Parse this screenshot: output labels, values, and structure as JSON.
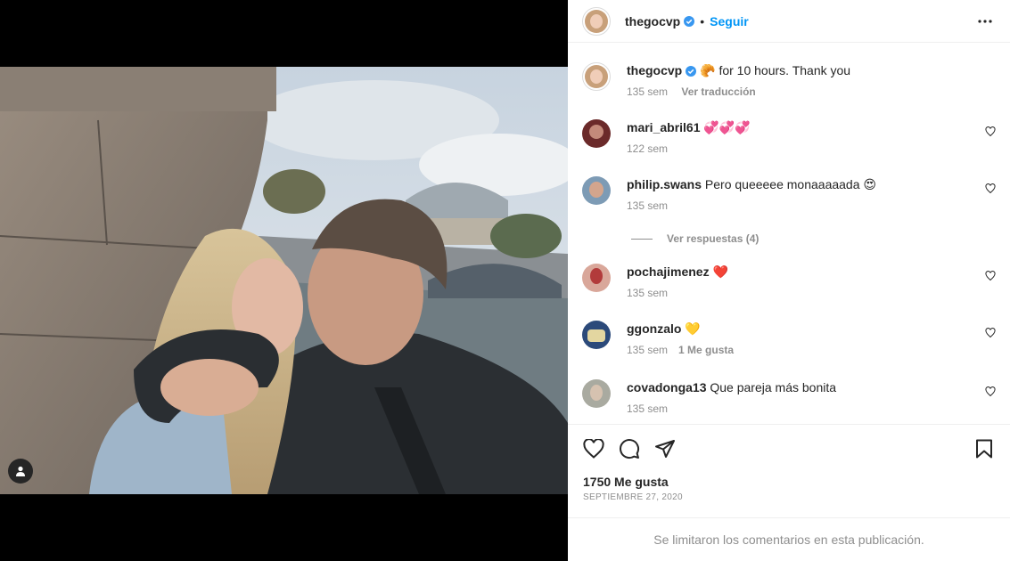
{
  "post": {
    "author": "thegocvp",
    "follow_label": "Seguir",
    "dot": "•",
    "caption_emoji": "🥐",
    "caption_text": "for 10 hours. Thank you",
    "caption_time": "135 sem",
    "translate_label": "Ver traducción"
  },
  "comments": [
    {
      "user": "mari_abril61",
      "text": "💞💞💞",
      "time": "122 sem",
      "likes": ""
    },
    {
      "user": "philip.swans",
      "text": "Pero queeeee monaaaaada 😍",
      "time": "135 sem",
      "likes": ""
    },
    {
      "user": "pochajimenez",
      "text": "❤️",
      "time": "135 sem",
      "likes": ""
    },
    {
      "user": "ggonzalo",
      "text": "💛",
      "time": "135 sem",
      "likes": "1 Me gusta"
    },
    {
      "user": "covadonga13",
      "text": "Que pareja más bonita",
      "time": "135 sem",
      "likes": ""
    }
  ],
  "replies_label": "Ver respuestas (4)",
  "likes_count": "1750 Me gusta",
  "date": "Septiembre 27, 2020",
  "comments_limited": "Se limitaron los comentarios en esta publicación.",
  "colors": {
    "accent": "#0095f6",
    "verified": "#3897f0",
    "muted": "#8e8e8e",
    "text": "#262626"
  },
  "icons": [
    "more-icon",
    "verified-icon",
    "heart-icon",
    "comment-icon",
    "share-icon",
    "save-icon",
    "user-tag-icon"
  ]
}
